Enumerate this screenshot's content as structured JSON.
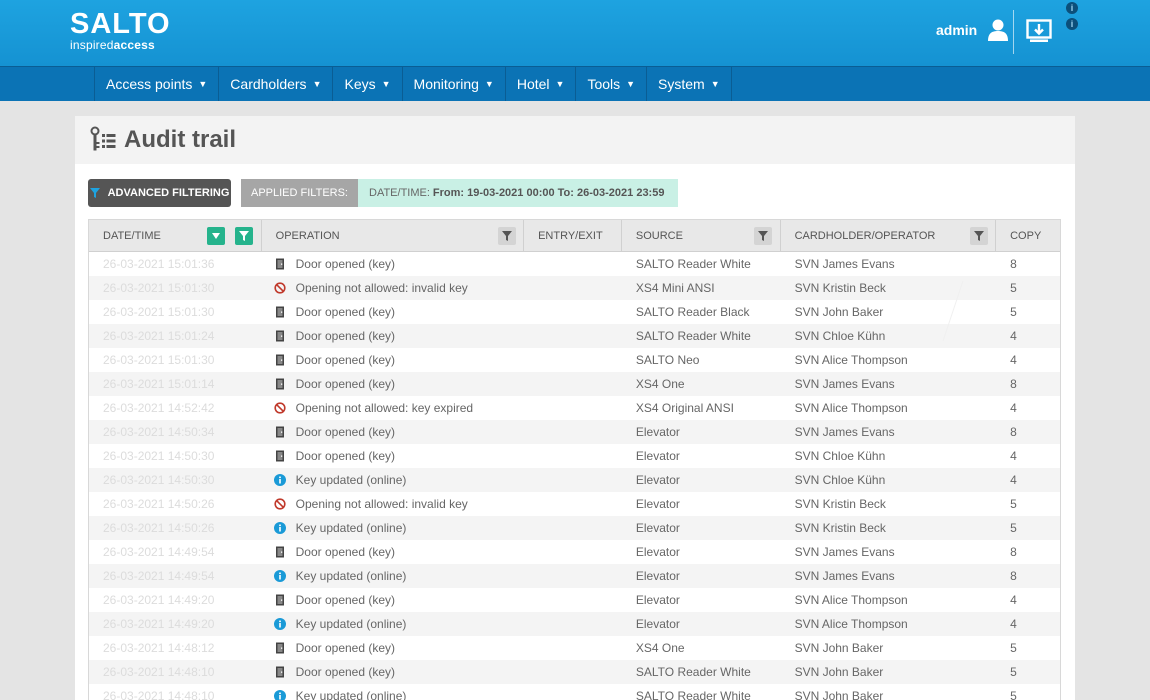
{
  "brand": {
    "name": "SALTO",
    "tagline_regular": "inspired",
    "tagline_bold": "access"
  },
  "header": {
    "user_label": "admin",
    "info_glyph": "i"
  },
  "nav": [
    {
      "label": "Access points"
    },
    {
      "label": "Cardholders"
    },
    {
      "label": "Keys"
    },
    {
      "label": "Monitoring"
    },
    {
      "label": "Hotel"
    },
    {
      "label": "Tools"
    },
    {
      "label": "System"
    }
  ],
  "page": {
    "title": "Audit trail"
  },
  "filters": {
    "advanced_label": "ADVANCED FILTERING",
    "applied_label": "APPLIED FILTERS:",
    "applied_prefix": "DATE/TIME:",
    "applied_value": "From: 19-03-2021 00:00 To: 26-03-2021 23:59"
  },
  "table": {
    "columns": [
      "DATE/TIME",
      "OPERATION",
      "ENTRY/EXIT",
      "SOURCE",
      "CARDHOLDER/OPERATOR",
      "COPY"
    ],
    "rows": [
      {
        "date": "26-03-2021 15:01:36",
        "icon": "door-icon",
        "operation": "Door opened (key)",
        "entry": "",
        "source": "SALTO Reader White",
        "cardholder": "SVN James Evans",
        "copy": "8"
      },
      {
        "date": "26-03-2021 15:01:30",
        "icon": "denied-icon",
        "operation": "Opening not allowed: invalid key",
        "entry": "",
        "source": "XS4 Mini ANSI",
        "cardholder": "SVN Kristin Beck",
        "copy": "5"
      },
      {
        "date": "26-03-2021 15:01:30",
        "icon": "door-icon",
        "operation": "Door opened (key)",
        "entry": "",
        "source": "SALTO Reader Black",
        "cardholder": "SVN John Baker",
        "copy": "5"
      },
      {
        "date": "26-03-2021 15:01:24",
        "icon": "door-icon",
        "operation": "Door opened (key)",
        "entry": "",
        "source": "SALTO Reader White",
        "cardholder": "SVN Chloe Kühn",
        "copy": "4"
      },
      {
        "date": "26-03-2021 15:01:30",
        "icon": "door-icon",
        "operation": "Door opened (key)",
        "entry": "",
        "source": "SALTO Neo",
        "cardholder": "SVN Alice Thompson",
        "copy": "4"
      },
      {
        "date": "26-03-2021 15:01:14",
        "icon": "door-icon",
        "operation": "Door opened (key)",
        "entry": "",
        "source": "XS4 One",
        "cardholder": "SVN James Evans",
        "copy": "8"
      },
      {
        "date": "26-03-2021 14:52:42",
        "icon": "denied-icon",
        "operation": "Opening not allowed: key expired",
        "entry": "",
        "source": "XS4 Original ANSI",
        "cardholder": "SVN Alice Thompson",
        "copy": "4"
      },
      {
        "date": "26-03-2021 14:50:34",
        "icon": "door-icon",
        "operation": "Door opened (key)",
        "entry": "",
        "source": "Elevator",
        "cardholder": "SVN James Evans",
        "copy": "8"
      },
      {
        "date": "26-03-2021 14:50:30",
        "icon": "door-icon",
        "operation": "Door opened (key)",
        "entry": "",
        "source": "Elevator",
        "cardholder": "SVN Chloe Kühn",
        "copy": "4"
      },
      {
        "date": "26-03-2021 14:50:30",
        "icon": "info-icon",
        "operation": "Key updated (online)",
        "entry": "",
        "source": "Elevator",
        "cardholder": "SVN Chloe Kühn",
        "copy": "4"
      },
      {
        "date": "26-03-2021 14:50:26",
        "icon": "denied-icon",
        "operation": "Opening not allowed: invalid key",
        "entry": "",
        "source": "Elevator",
        "cardholder": "SVN Kristin Beck",
        "copy": "5"
      },
      {
        "date": "26-03-2021 14:50:26",
        "icon": "info-icon",
        "operation": "Key updated (online)",
        "entry": "",
        "source": "Elevator",
        "cardholder": "SVN Kristin Beck",
        "copy": "5"
      },
      {
        "date": "26-03-2021 14:49:54",
        "icon": "door-icon",
        "operation": "Door opened (key)",
        "entry": "",
        "source": "Elevator",
        "cardholder": "SVN James Evans",
        "copy": "8"
      },
      {
        "date": "26-03-2021 14:49:54",
        "icon": "info-icon",
        "operation": "Key updated (online)",
        "entry": "",
        "source": "Elevator",
        "cardholder": "SVN James Evans",
        "copy": "8"
      },
      {
        "date": "26-03-2021 14:49:20",
        "icon": "door-icon",
        "operation": "Door opened (key)",
        "entry": "",
        "source": "Elevator",
        "cardholder": "SVN Alice Thompson",
        "copy": "4"
      },
      {
        "date": "26-03-2021 14:49:20",
        "icon": "info-icon",
        "operation": "Key updated (online)",
        "entry": "",
        "source": "Elevator",
        "cardholder": "SVN Alice Thompson",
        "copy": "4"
      },
      {
        "date": "26-03-2021 14:48:12",
        "icon": "door-icon",
        "operation": "Door opened (key)",
        "entry": "",
        "source": "XS4 One",
        "cardholder": "SVN John Baker",
        "copy": "5"
      },
      {
        "date": "26-03-2021 14:48:10",
        "icon": "door-icon",
        "operation": "Door opened (key)",
        "entry": "",
        "source": "SALTO Reader White",
        "cardholder": "SVN John Baker",
        "copy": "5"
      },
      {
        "date": "26-03-2021 14:48:10",
        "icon": "info-icon",
        "operation": "Key updated (online)",
        "entry": "",
        "source": "SALTO Reader White",
        "cardholder": "SVN John Baker",
        "copy": "5"
      }
    ]
  },
  "colors": {
    "header_blue": "#1592d2",
    "nav_blue": "#0b73b5",
    "filter_green": "#25b38c",
    "applied_bg": "#c9f0e5",
    "denied_red": "#c0392b",
    "info_blue": "#1a9ad7"
  }
}
